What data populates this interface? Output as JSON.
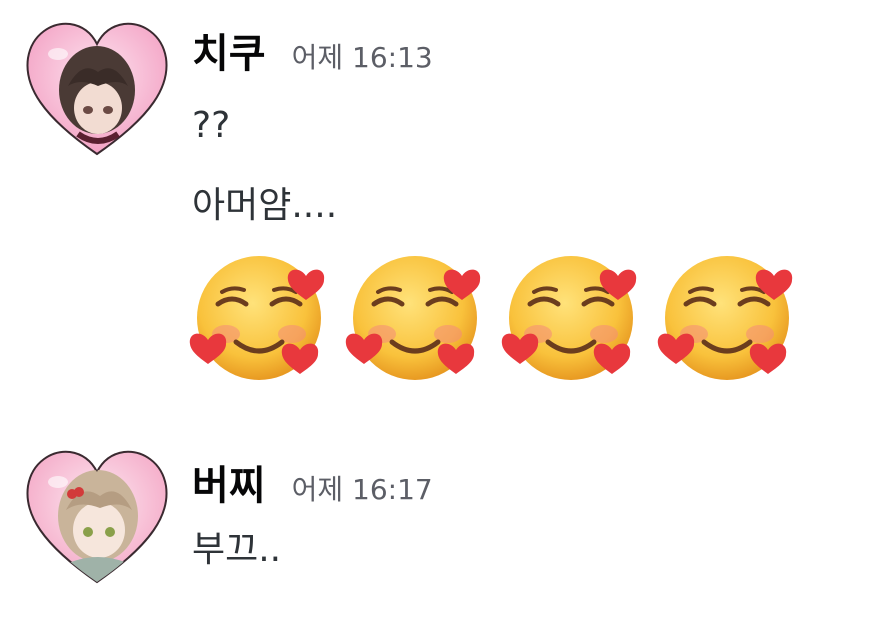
{
  "messages": [
    {
      "author": "치쿠",
      "timestamp": "어제 16:13",
      "lines": [
        "??",
        "아머얌...."
      ],
      "emoji": [
        "smiling-face-with-hearts",
        "smiling-face-with-hearts",
        "smiling-face-with-hearts",
        "smiling-face-with-hearts"
      ]
    },
    {
      "author": "버찌",
      "timestamp": "어제 16:17",
      "lines": [
        "부끄.."
      ]
    }
  ],
  "colors": {
    "username": "#060607",
    "timestamp": "#5c5e66",
    "text": "#2e3338",
    "avatar_frame": "#f6a6c8",
    "emoji_face": "#f9c23c",
    "emoji_heart": "#e8383d"
  }
}
